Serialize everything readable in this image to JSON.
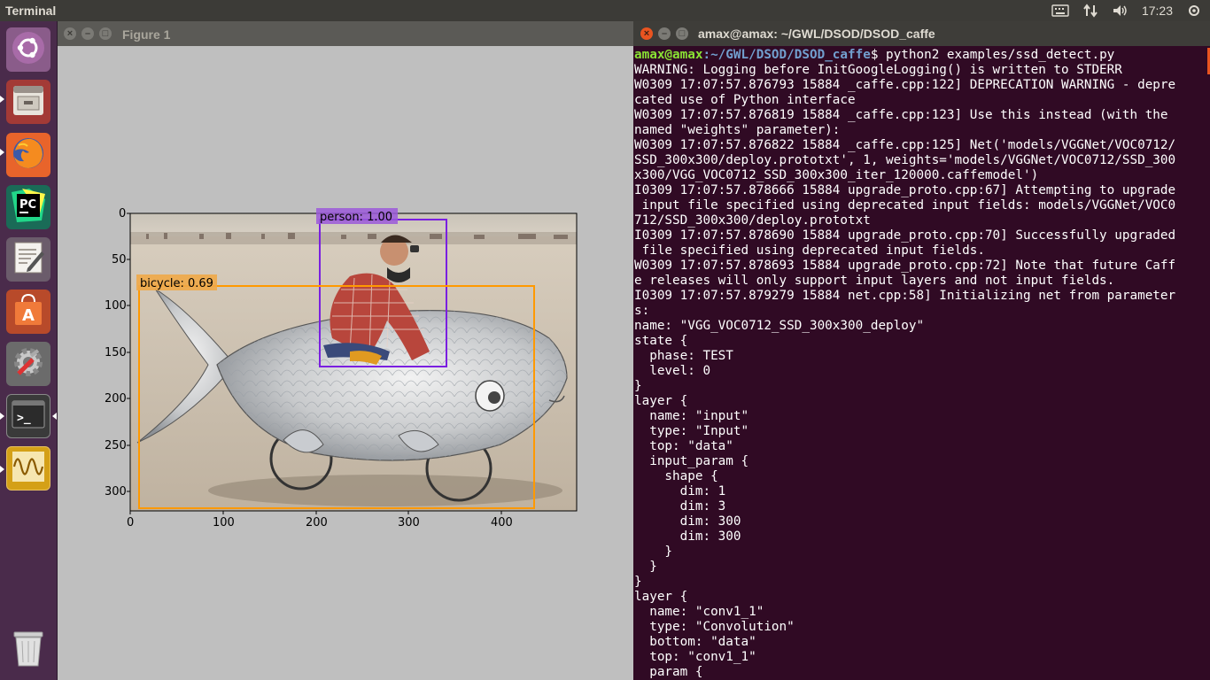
{
  "top_panel": {
    "app_title": "Terminal",
    "clock": "17:23"
  },
  "launcher": {
    "items": [
      {
        "name": "ubuntu-dash",
        "icon": "ubuntu-logo-icon"
      },
      {
        "name": "files",
        "icon": "file-cabinet-icon"
      },
      {
        "name": "firefox",
        "icon": "firefox-icon"
      },
      {
        "name": "pycharm",
        "icon": "pycharm-icon",
        "label": "PC"
      },
      {
        "name": "text-editor",
        "icon": "text-editor-icon"
      },
      {
        "name": "software-center",
        "icon": "shopping-bag-icon",
        "label": "A"
      },
      {
        "name": "system-settings",
        "icon": "settings-icon"
      },
      {
        "name": "terminal",
        "icon": "terminal-icon",
        "label": ">_"
      },
      {
        "name": "system-monitor",
        "icon": "waveform-icon"
      },
      {
        "name": "trash",
        "icon": "trash-icon"
      }
    ]
  },
  "figure_window": {
    "title": "Figure 1",
    "close": "×",
    "minimize": "–",
    "maximize": "□"
  },
  "terminal_window": {
    "title": "amax@amax: ~/GWL/DSOD/DSOD_caffe",
    "close": "×",
    "minimize": "–",
    "maximize": "□",
    "prompt_user": "amax@amax",
    "prompt_path": ":~/GWL/DSOD/DSOD_caffe",
    "prompt_command": "$ python2 examples/ssd_detect.py",
    "lines": [
      "WARNING: Logging before InitGoogleLogging() is written to STDERR",
      "W0309 17:07:57.876793 15884 _caffe.cpp:122] DEPRECATION WARNING - depre",
      "cated use of Python interface",
      "W0309 17:07:57.876819 15884 _caffe.cpp:123] Use this instead (with the",
      "named \"weights\" parameter):",
      "W0309 17:07:57.876822 15884 _caffe.cpp:125] Net('models/VGGNet/VOC0712/",
      "SSD_300x300/deploy.prototxt', 1, weights='models/VGGNet/VOC0712/SSD_300",
      "x300/VGG_VOC0712_SSD_300x300_iter_120000.caffemodel')",
      "I0309 17:07:57.878666 15884 upgrade_proto.cpp:67] Attempting to upgrade",
      " input file specified using deprecated input fields: models/VGGNet/VOC0",
      "712/SSD_300x300/deploy.prototxt",
      "I0309 17:07:57.878690 15884 upgrade_proto.cpp:70] Successfully upgraded",
      " file specified using deprecated input fields.",
      "W0309 17:07:57.878693 15884 upgrade_proto.cpp:72] Note that future Caff",
      "e releases will only support input layers and not input fields.",
      "I0309 17:07:57.879279 15884 net.cpp:58] Initializing net from parameter",
      "s:",
      "name: \"VGG_VOC0712_SSD_300x300_deploy\"",
      "state {",
      "  phase: TEST",
      "  level: 0",
      "}",
      "layer {",
      "  name: \"input\"",
      "  type: \"Input\"",
      "  top: \"data\"",
      "  input_param {",
      "    shape {",
      "      dim: 1",
      "      dim: 3",
      "      dim: 300",
      "      dim: 300",
      "    }",
      "  }",
      "}",
      "layer {",
      "  name: \"conv1_1\"",
      "  type: \"Convolution\"",
      "  bottom: \"data\"",
      "  top: \"conv1_1\"",
      "  param {"
    ]
  },
  "plot": {
    "x_ticks": [
      "0",
      "100",
      "200",
      "300",
      "400"
    ],
    "y_ticks": [
      "0",
      "50",
      "100",
      "150",
      "200",
      "250",
      "300"
    ],
    "detections": [
      {
        "label": "person: 1.00",
        "color": "#7a1fe0",
        "label_bg": "#9b59d9"
      },
      {
        "label": "bicycle: 0.69",
        "color": "#ff9900",
        "label_bg": "#f0a848"
      }
    ]
  }
}
